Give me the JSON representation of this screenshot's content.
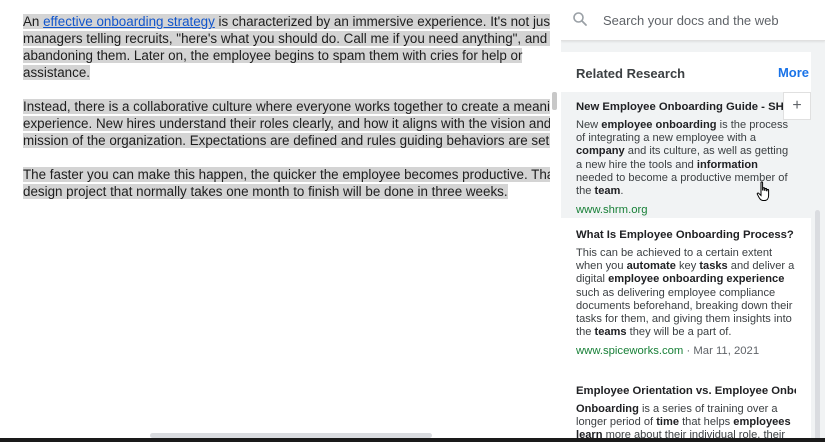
{
  "document": {
    "p1": {
      "intro": "An ",
      "link": "effective onboarding strategy",
      "line1_rest": " is characterized by an immersive experience. It's not just",
      "line2": "managers telling recruits, \"here's what you should do. Call me if you need anything\", and then",
      "line3": "abandoning them. Later on, the employee begins to spam them with cries for help or",
      "line4": "assistance."
    },
    "p2": {
      "line1": "Instead, there is a collaborative culture where everyone works together to create a meaningful",
      "line2": "experience. New hires understand their roles clearly, and how it aligns with the vision and",
      "line3": "mission of the organization. Expectations are defined and rules guiding behaviors are set."
    },
    "p3": {
      "line1": "The faster you can make this happen, the quicker the employee becomes productive. That UI",
      "line2": "design project that normally takes one month to finish will be done in three weeks."
    }
  },
  "panel": {
    "search_placeholder": "Search your docs and the web",
    "header": "Related Research",
    "more_label": "More",
    "add_label": "+",
    "results": [
      {
        "title": "New Employee Onboarding Guide - SHRM",
        "source": "www.shrm.org",
        "date": ""
      },
      {
        "title": "What Is Employee Onboarding Process? ...",
        "source": "www.spiceworks.com",
        "date": " · Mar 11, 2021"
      },
      {
        "title": "Employee Orientation vs. Employee Onbo...",
        "source": "",
        "date": ""
      }
    ]
  },
  "icons": {
    "search": "search-icon",
    "cursor": "hand-cursor-icon"
  },
  "colors": {
    "selection": "#d4d4d4",
    "link": "#1155cc",
    "accent": "#1a73e8",
    "source": "#188038"
  }
}
